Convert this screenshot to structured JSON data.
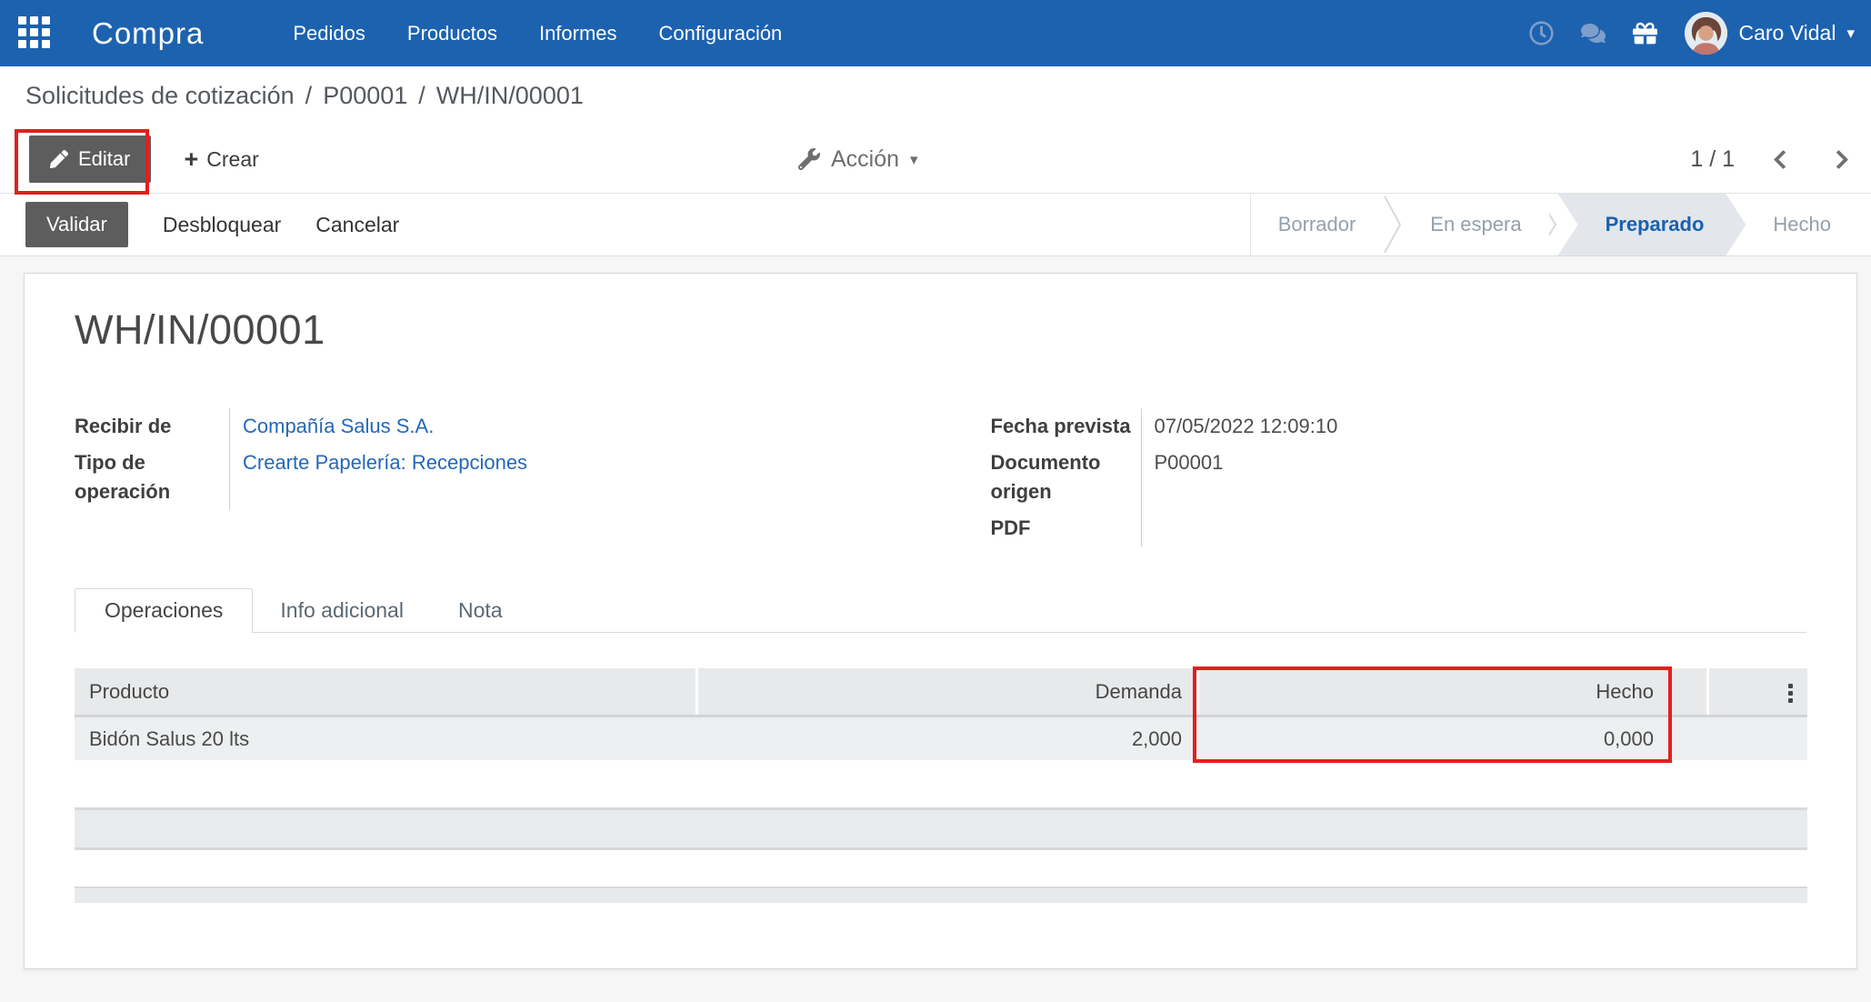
{
  "colors": {
    "navbar_blue": "#1d62af",
    "annotation_red": "#e0201e",
    "link_blue": "#2468b8",
    "active_step_blue": "#1a61ae",
    "dark_button_gray": "#5d5d5d",
    "table_header_gray": "#e8e9ea",
    "table_row_gray": "#edeff0"
  },
  "icons": {
    "plus": "+",
    "caret_down": "▾"
  },
  "navbar": {
    "app_name": "Compra",
    "menus": [
      "Pedidos",
      "Productos",
      "Informes",
      "Configuración"
    ],
    "user": {
      "name": "Caro Vidal"
    }
  },
  "breadcrumb": {
    "items": [
      "Solicitudes de cotización",
      "P00001",
      "WH/IN/00001"
    ],
    "separator": "/"
  },
  "control_panel": {
    "edit": "Editar",
    "create": "Crear",
    "action": "Acción",
    "pager": {
      "value": "1 / 1"
    }
  },
  "status_actions": {
    "validate": "Validar",
    "unlock": "Desbloquear",
    "cancel": "Cancelar"
  },
  "statusbar": {
    "steps": [
      {
        "label": "Borrador",
        "active": false
      },
      {
        "label": "En espera",
        "active": false
      },
      {
        "label": "Preparado",
        "active": true
      },
      {
        "label": "Hecho",
        "active": false
      }
    ]
  },
  "document": {
    "title": "WH/IN/00001",
    "fields_left": [
      {
        "label": "Recibir de",
        "value": "Compañía Salus S.A."
      },
      {
        "label": "Tipo de operación",
        "value": "Crearte Papelería: Recepciones"
      }
    ],
    "fields_right": [
      {
        "label": "Fecha prevista",
        "value": "07/05/2022 12:09:10"
      },
      {
        "label": "Documento origen",
        "value": "P00001"
      },
      {
        "label": "PDF",
        "value": ""
      }
    ],
    "tabs": [
      {
        "label": "Operaciones",
        "active": true
      },
      {
        "label": "Info adicional",
        "active": false
      },
      {
        "label": "Nota",
        "active": false
      }
    ],
    "operations_table": {
      "columns": [
        "Producto",
        "Demanda",
        "Hecho"
      ],
      "rows": [
        {
          "producto": "Bidón Salus 20 lts",
          "demanda": "2,000",
          "hecho": "0,000"
        }
      ]
    }
  }
}
